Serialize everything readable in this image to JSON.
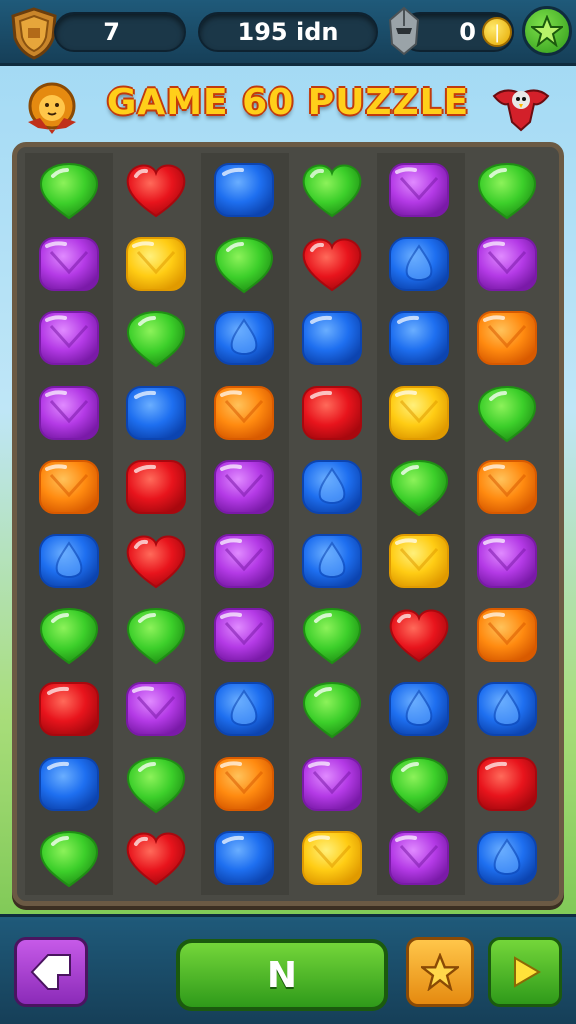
{
  "header": {
    "level_value": "7",
    "score_text": "195 idn",
    "coins_value": "0"
  },
  "title": {
    "text": "GAME 60 PUZZLE"
  },
  "board": {
    "rows": 10,
    "cols": 6,
    "gems": [
      [
        "green-drop",
        "red-heart",
        "blue-square",
        "green-heart",
        "purple-heart",
        "green-drop"
      ],
      [
        "purple-heart",
        "yellow-heart",
        "green-drop",
        "red-heart",
        "blue-drop",
        "purple-heart"
      ],
      [
        "purple-heart",
        "green-drop",
        "blue-drop",
        "blue-square",
        "blue-square",
        "orange-heart"
      ],
      [
        "purple-heart",
        "blue-square",
        "orange-heart",
        "red-square",
        "yellow-heart",
        "green-drop"
      ],
      [
        "orange-heart",
        "red-square",
        "purple-heart",
        "blue-drop",
        "green-drop",
        "orange-heart"
      ],
      [
        "blue-drop",
        "red-heart",
        "purple-heart",
        "blue-drop",
        "yellow-heart",
        "purple-heart"
      ],
      [
        "green-drop",
        "green-drop",
        "purple-heart",
        "green-drop",
        "red-heart",
        "orange-heart"
      ],
      [
        "red-square",
        "purple-heart",
        "blue-drop",
        "green-drop",
        "blue-drop",
        "blue-drop"
      ],
      [
        "blue-square",
        "green-drop",
        "orange-heart",
        "purple-heart",
        "green-drop",
        "red-square"
      ],
      [
        "green-drop",
        "red-heart",
        "blue-square",
        "yellow-heart",
        "purple-heart",
        "blue-drop"
      ]
    ]
  },
  "footer": {
    "main_button_label": "N"
  },
  "icons": {
    "shield": "shield-icon",
    "helmet": "helmet-icon",
    "coin": "coin-icon",
    "star": "star-icon",
    "lion": "lion-emblem-icon",
    "bird": "bird-emblem-icon",
    "back": "back-arrow-icon",
    "play": "play-icon"
  },
  "colors": {
    "green": "#3ccf2a",
    "red": "#e8141c",
    "blue": "#1e6ff0",
    "purple": "#b43ae6",
    "yellow": "#ffcc14",
    "orange": "#ff8a10"
  }
}
